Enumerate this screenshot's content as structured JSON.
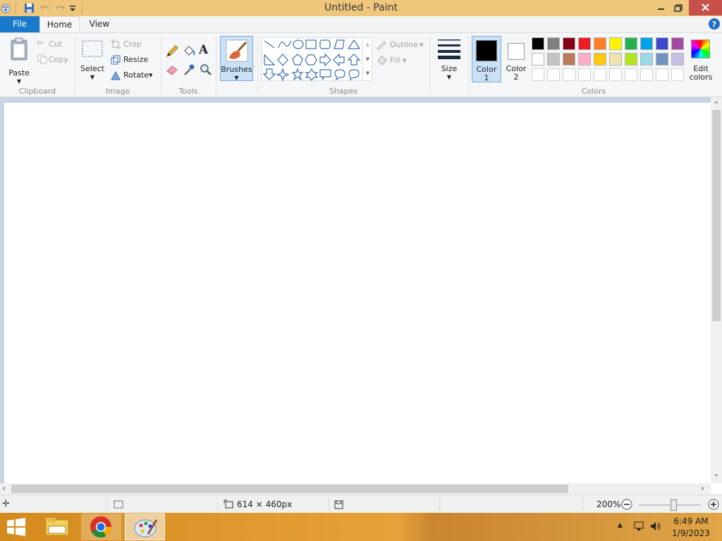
{
  "window": {
    "title": "Untitled - Paint"
  },
  "tabs": {
    "file": "File",
    "home": "Home",
    "view": "View"
  },
  "clipboard": {
    "paste": "Paste",
    "cut": "Cut",
    "copy": "Copy",
    "group": "Clipboard"
  },
  "image": {
    "select": "Select",
    "crop": "Crop",
    "resize": "Resize",
    "rotate": "Rotate",
    "group": "Image"
  },
  "tools": {
    "group": "Tools"
  },
  "brushes": {
    "label": "Brushes"
  },
  "shapes": {
    "outline": "Outline",
    "fill": "Fill",
    "group": "Shapes"
  },
  "size": {
    "label": "Size"
  },
  "colors": {
    "color1": "Color",
    "color1_num": "1",
    "color2": "Color",
    "color2_num": "2",
    "edit": "Edit",
    "edit2": "colors",
    "group": "Colors",
    "color1_value": "#000000",
    "color2_value": "#ffffff",
    "palette_row1": [
      "#000000",
      "#7f7f7f",
      "#880015",
      "#ed1c24",
      "#ff7f27",
      "#fff200",
      "#22b14c",
      "#00a2e8",
      "#3f48cc",
      "#a349a4"
    ],
    "palette_row2": [
      "#ffffff",
      "#c3c3c3",
      "#b97a57",
      "#ffaec9",
      "#ffc90e",
      "#efe4b0",
      "#b5e61d",
      "#99d9ea",
      "#7092be",
      "#c8bfe7"
    ]
  },
  "status": {
    "dimensions": "614 × 460px",
    "zoom": "200%"
  },
  "tray": {
    "time": "6:49 AM",
    "date": "1/9/2023"
  }
}
